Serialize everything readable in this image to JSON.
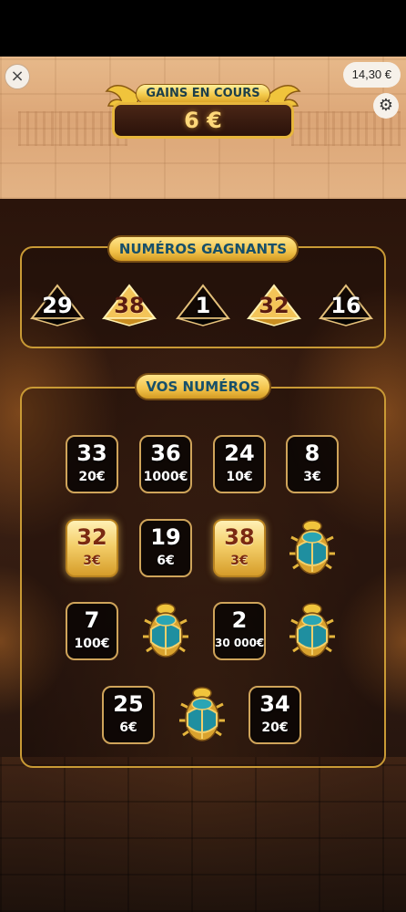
{
  "header": {
    "close_glyph": "×",
    "balance": "14,30 €",
    "settings_glyph": "⚙",
    "gains_label": "GAINS EN COURS",
    "gains_value": "6 €"
  },
  "winning": {
    "title": "NUMÉROS GAGNANTS",
    "numbers": [
      {
        "value": "29",
        "style": "dark"
      },
      {
        "value": "38",
        "style": "gold"
      },
      {
        "value": "1",
        "style": "dark"
      },
      {
        "value": "32",
        "style": "gold"
      },
      {
        "value": "16",
        "style": "dark"
      }
    ]
  },
  "mine": {
    "title": "VOS NUMÉROS",
    "rows": [
      [
        {
          "type": "number",
          "value": "33",
          "prize": "20€",
          "style": "dark"
        },
        {
          "type": "number",
          "value": "36",
          "prize": "1000€",
          "style": "dark"
        },
        {
          "type": "number",
          "value": "24",
          "prize": "10€",
          "style": "dark"
        },
        {
          "type": "number",
          "value": "8",
          "prize": "3€",
          "style": "dark"
        }
      ],
      [
        {
          "type": "number",
          "value": "32",
          "prize": "3€",
          "style": "gold"
        },
        {
          "type": "number",
          "value": "19",
          "prize": "6€",
          "style": "dark"
        },
        {
          "type": "number",
          "value": "38",
          "prize": "3€",
          "style": "gold"
        },
        {
          "type": "scarab",
          "icon": "scarab-icon"
        }
      ],
      [
        {
          "type": "number",
          "value": "7",
          "prize": "100€",
          "style": "dark"
        },
        {
          "type": "scarab",
          "icon": "scarab-icon"
        },
        {
          "type": "number",
          "value": "2",
          "prize": "30 000€",
          "style": "dark"
        },
        {
          "type": "scarab",
          "icon": "scarab-icon"
        }
      ],
      [
        {
          "type": "number",
          "value": "25",
          "prize": "6€",
          "style": "dark"
        },
        {
          "type": "scarab",
          "icon": "scarab-icon"
        },
        {
          "type": "number",
          "value": "34",
          "prize": "20€",
          "style": "dark"
        }
      ]
    ]
  },
  "colors": {
    "gold": "#f2c24a",
    "panel_border": "#c99a35",
    "title_text": "#17506a",
    "dark_tile": "#0a0604"
  }
}
